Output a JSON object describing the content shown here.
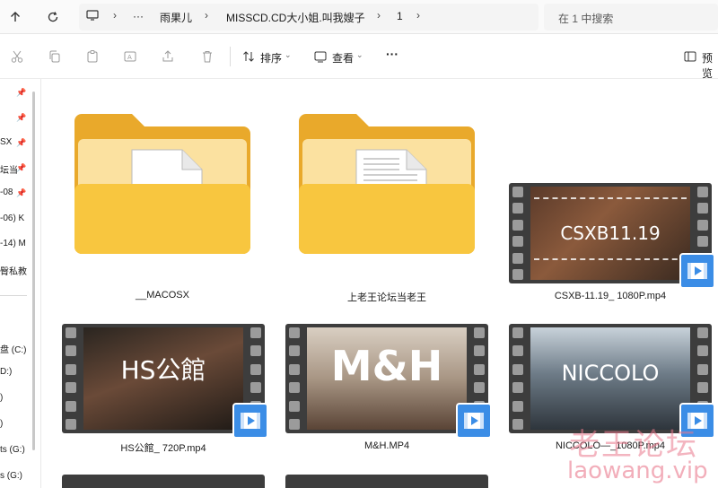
{
  "address_bar": {
    "breadcrumbs": [
      "雨果儿",
      "MISSCD.CD大小姐.叫我嫂子",
      "1"
    ],
    "overflow": "···",
    "search_placeholder": "在 1 中搜索"
  },
  "command_bar": {
    "sort_label": "排序",
    "view_label": "查看",
    "more_label": "···",
    "details_label": "预览"
  },
  "sidebar": {
    "items": [
      {
        "label": "",
        "pinned": true
      },
      {
        "label": "",
        "pinned": true
      },
      {
        "label": "SX",
        "pinned": true
      },
      {
        "label": "坛当",
        "pinned": true
      },
      {
        "label": "-08",
        "pinned": true
      },
      {
        "label": "-06) K",
        "pinned": false
      },
      {
        "label": "-14) M",
        "pinned": false
      },
      {
        "label": "臀私教",
        "pinned": false
      }
    ],
    "drives": [
      "盘 (C:)",
      "D:)",
      ")",
      ")",
      "ts (G:)",
      "s (G:)"
    ]
  },
  "files": [
    {
      "name": "__MACOSX",
      "type": "folder",
      "icon": "folder-blank-icon"
    },
    {
      "name": "上老王论坛当老王",
      "type": "folder",
      "icon": "folder-doc-icon"
    },
    {
      "name": "CSXB-11.19_ 1080P.mp4",
      "type": "video",
      "thumb_text": "CSXB11.19"
    },
    {
      "name": "HS公館_ 720P.mp4",
      "type": "video",
      "thumb_text": "HS公館"
    },
    {
      "name": "M&H.MP4",
      "type": "video",
      "thumb_text": "M&H"
    },
    {
      "name": "NICCOLO—_1080P.mp4",
      "type": "video",
      "thumb_text": "NICCOLO"
    }
  ],
  "watermark": {
    "cn": "老王论坛",
    "url": "laowang.vip"
  },
  "colors": {
    "folder": "#f5c542",
    "video_badge": "#3b8de6",
    "film": "#3d3d3d"
  }
}
